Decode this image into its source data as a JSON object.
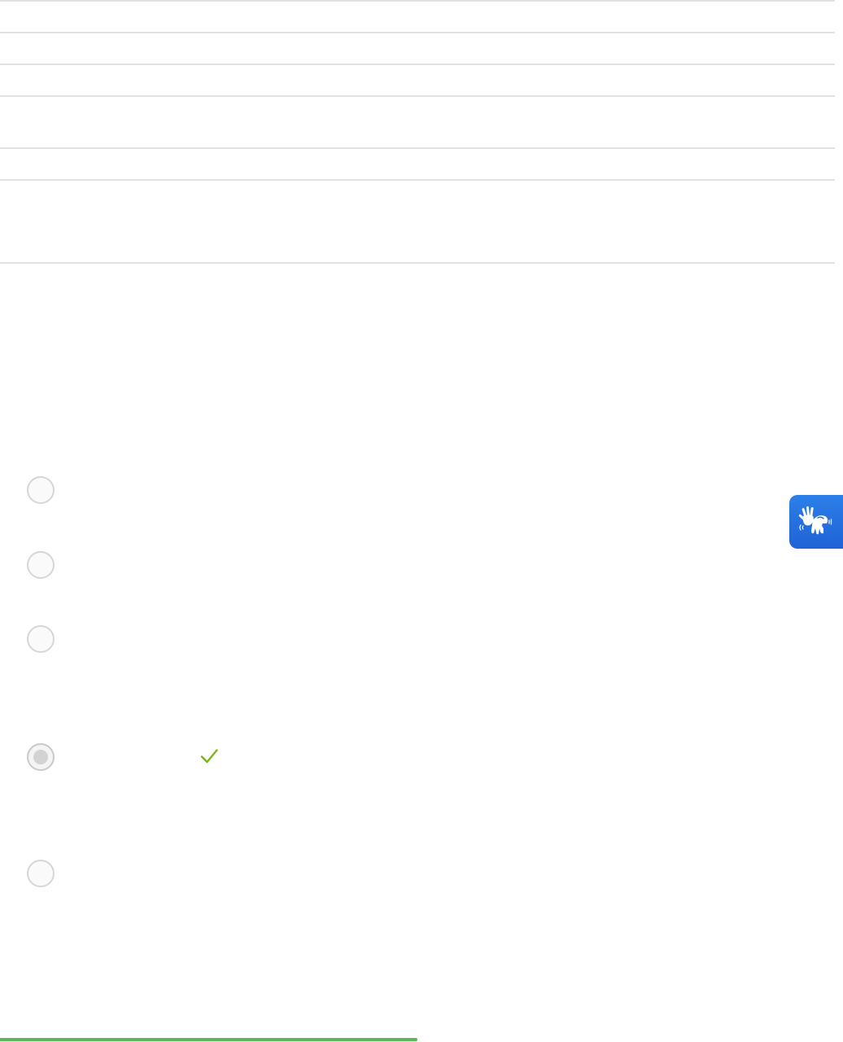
{
  "quiz": {
    "answers": [
      {
        "selected": false
      },
      {
        "selected": false
      },
      {
        "selected": false
      },
      {
        "selected": true,
        "correct": true
      },
      {
        "selected": false
      }
    ]
  },
  "icons": {
    "correct": "checkmark-icon",
    "accessibility": "sign-language-icon"
  },
  "colors": {
    "accent_blue": "#1f6fe0",
    "check_green": "#7ab51d",
    "progress_green": "#5cb85c",
    "radio_border": "#d6d6d6",
    "divider": "#e2e2e2"
  },
  "progress": {
    "fraction": 0.5
  }
}
